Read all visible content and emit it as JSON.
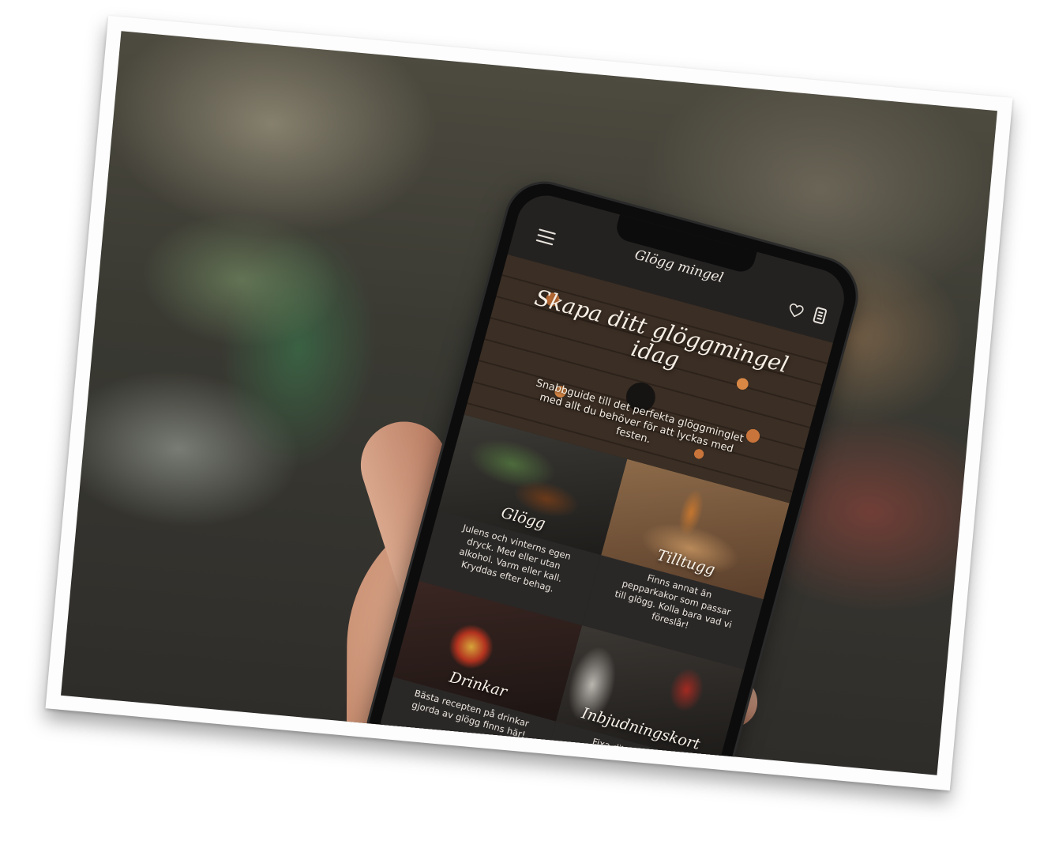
{
  "app": {
    "logo": "Glögg mingel"
  },
  "hero": {
    "title": "Skapa ditt glöggmingel idag",
    "subtitle": "Snabbguide till det perfekta glöggminglet med allt du behöver för att lyckas med festen."
  },
  "cards": [
    {
      "label": "Glögg",
      "text": "Julens och vinterns egen dryck. Med eller utan alkohol. Varm eller kall. Kryddas efter behag."
    },
    {
      "label": "Tilltugg",
      "text": "Finns annat än pepparkakor som passar till glögg. Kolla bara vad vi föreslår!"
    },
    {
      "label": "Drinkar",
      "text": "Bästa recepten på drinkar gjorda av glögg finns här!"
    },
    {
      "label": "Inbjudningskort",
      "text": "Fixa ditt personliga inbjudningskort på nolltid."
    }
  ],
  "icons": {
    "menu": "hamburger-menu-icon",
    "favorites": "heart-icon",
    "list": "list-icon"
  }
}
